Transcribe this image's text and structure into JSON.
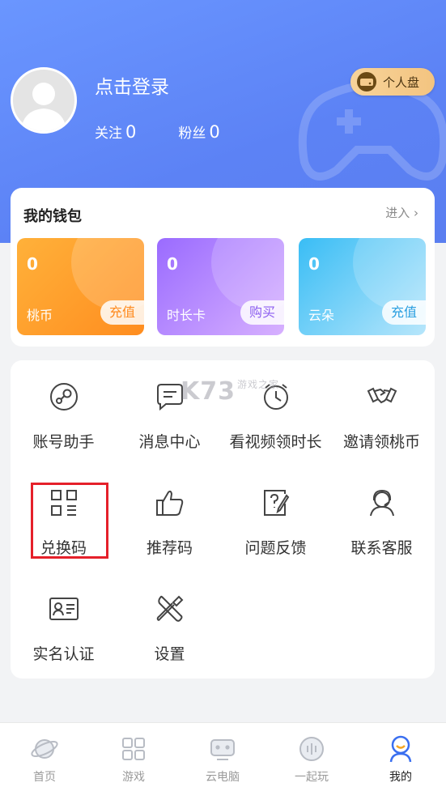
{
  "profile": {
    "login_text": "点击登录",
    "follow_label": "关注",
    "follow_count": "0",
    "fans_label": "粉丝",
    "fans_count": "0",
    "disk_button": "个人盘"
  },
  "wallet": {
    "title": "我的钱包",
    "enter": "进入 ›",
    "cards": [
      {
        "value": "0",
        "label": "桃币",
        "action": "充值",
        "color": "#ff9a28"
      },
      {
        "value": "0",
        "label": "时长卡",
        "action": "购买",
        "color": "#a978ff"
      },
      {
        "value": "0",
        "label": "云朵",
        "action": "充值",
        "color": "#3dbdf5"
      }
    ]
  },
  "menu": {
    "items": [
      {
        "label": "账号助手",
        "icon": "steam-icon"
      },
      {
        "label": "消息中心",
        "icon": "message-icon"
      },
      {
        "label": "看视频领时长",
        "icon": "clock-icon"
      },
      {
        "label": "邀请领桃币",
        "icon": "handshake-icon"
      },
      {
        "label": "兑换码",
        "icon": "qrcode-icon"
      },
      {
        "label": "推荐码",
        "icon": "thumbs-up-icon"
      },
      {
        "label": "问题反馈",
        "icon": "feedback-icon"
      },
      {
        "label": "联系客服",
        "icon": "customer-service-icon"
      },
      {
        "label": "实名认证",
        "icon": "id-card-icon"
      },
      {
        "label": "设置",
        "icon": "tools-icon"
      }
    ]
  },
  "watermark": {
    "text": "K73",
    "sub": "游戏之家"
  },
  "tabbar": {
    "tabs": [
      {
        "label": "首页",
        "icon": "planet-icon"
      },
      {
        "label": "游戏",
        "icon": "grid-icon"
      },
      {
        "label": "云电脑",
        "icon": "cloud-pc-icon"
      },
      {
        "label": "一起玩",
        "icon": "play-together-icon"
      },
      {
        "label": "我的",
        "icon": "profile-icon"
      }
    ],
    "active_index": 4
  },
  "colors": {
    "header": "#6089f7",
    "highlight": "#e5202a",
    "disk_button": "#f5cb8c"
  }
}
